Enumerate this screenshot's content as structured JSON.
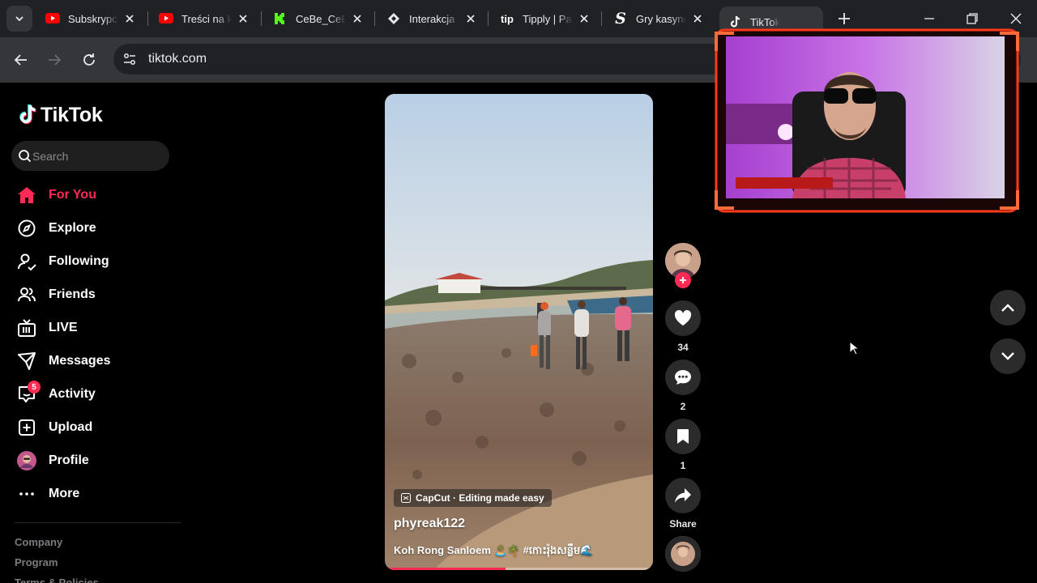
{
  "browser": {
    "tabs": [
      {
        "title": "Subskrypcje - YouTube",
        "icon": "youtube-icon"
      },
      {
        "title": "Treści na kanale - YouTube Studio",
        "icon": "youtube-icon"
      },
      {
        "title": "CeBe_CeBe - Kick",
        "icon": "kick-icon"
      },
      {
        "title": "Interakcja",
        "icon": "diamond-icon"
      },
      {
        "title": "Tipply | Panel",
        "icon": "tipply-icon"
      },
      {
        "title": "Gry kasynowe",
        "icon": "s-logo-icon"
      },
      {
        "title": "TikTok",
        "icon": "tiktok-icon",
        "active": true,
        "audio": true
      }
    ],
    "url": "tiktok.com"
  },
  "sidebar": {
    "logo_text": "TikTok",
    "search_placeholder": "Search",
    "nav": [
      {
        "label": "For You",
        "icon": "home-icon",
        "active": true
      },
      {
        "label": "Explore",
        "icon": "compass-icon"
      },
      {
        "label": "Following",
        "icon": "following-icon"
      },
      {
        "label": "Friends",
        "icon": "friends-icon"
      },
      {
        "label": "LIVE",
        "icon": "live-icon"
      },
      {
        "label": "Messages",
        "icon": "messages-icon"
      },
      {
        "label": "Activity",
        "icon": "activity-icon",
        "badge": "5"
      },
      {
        "label": "Upload",
        "icon": "upload-icon"
      },
      {
        "label": "Profile",
        "icon": "profile-avatar"
      },
      {
        "label": "More",
        "icon": "more-icon"
      }
    ],
    "footer": [
      "Company",
      "Program",
      "Terms & Policies"
    ]
  },
  "video": {
    "capcut_label": "CapCut · Editing made easy",
    "author": "phyreak122",
    "caption": "Koh Rong Sanloem 🏝️🌴 #កោះរ៉ុងសន្លឹម🌊",
    "progress": 0.45
  },
  "actions": {
    "likes": "34",
    "comments": "2",
    "saves": "1",
    "share_label": "Share"
  },
  "colors": {
    "accent": "#fe2c55",
    "background": "#000000",
    "chrome_dark": "#202124",
    "chrome_toolbar": "#35363a"
  }
}
